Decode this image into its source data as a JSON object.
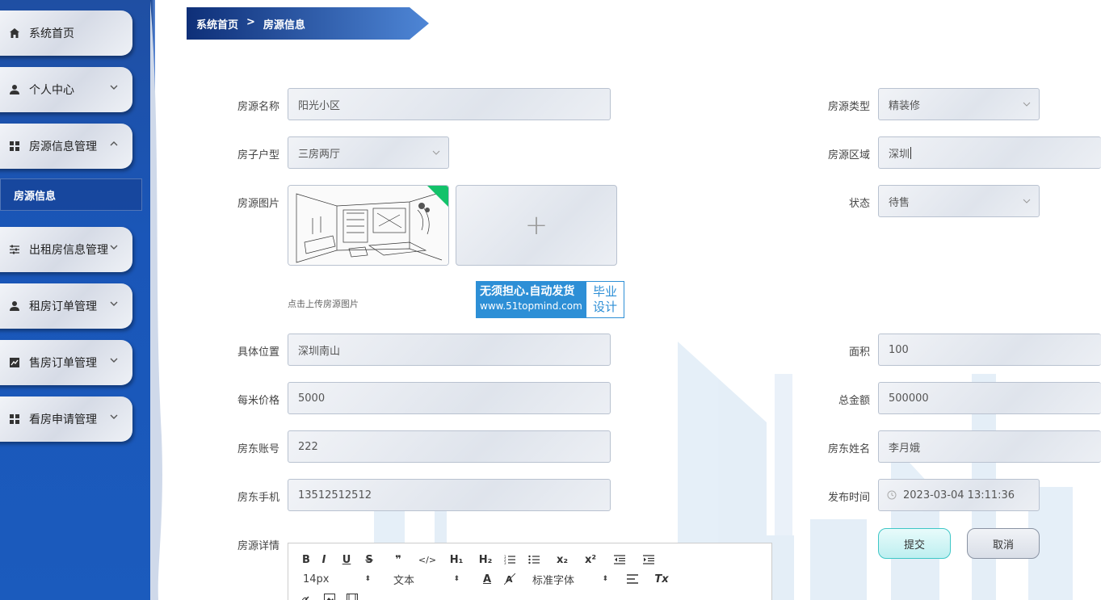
{
  "sidebar": {
    "items": [
      {
        "label": "系统首页",
        "icon": "home-icon"
      },
      {
        "label": "个人中心",
        "icon": "user-icon"
      },
      {
        "label": "房源信息管理",
        "icon": "grid-icon"
      },
      {
        "label": "出租房信息管理",
        "icon": "sliders-icon"
      },
      {
        "label": "租房订单管理",
        "icon": "user-icon"
      },
      {
        "label": "售房订单管理",
        "icon": "chart-icon"
      },
      {
        "label": "看房申请管理",
        "icon": "grid-icon"
      }
    ],
    "active_sub": "房源信息"
  },
  "breadcrumb": {
    "home": "系统首页",
    "sep": ">",
    "current": "房源信息"
  },
  "form": {
    "name": {
      "label": "房源名称",
      "value": "阳光小区"
    },
    "type": {
      "label": "房源类型",
      "value": "精装修"
    },
    "layout": {
      "label": "房子户型",
      "value": "三房两厅"
    },
    "region": {
      "label": "房源区域",
      "value": "深圳"
    },
    "image": {
      "label": "房源图片",
      "hint": "点击上传房源图片",
      "upload_symbol": "+"
    },
    "status": {
      "label": "状态",
      "value": "待售"
    },
    "location": {
      "label": "具体位置",
      "value": "深圳南山"
    },
    "area": {
      "label": "面积",
      "value": "100"
    },
    "unit_price": {
      "label": "每米价格",
      "value": "5000"
    },
    "total": {
      "label": "总金额",
      "value": "500000"
    },
    "owner_account": {
      "label": "房东账号",
      "value": "222"
    },
    "owner_name": {
      "label": "房东姓名",
      "value": "李月娥"
    },
    "owner_phone": {
      "label": "房东手机",
      "value": "13512512512"
    },
    "publish_time": {
      "label": "发布时间",
      "value": "2023-03-04 13:11:36"
    },
    "detail": {
      "label": "房源详情"
    }
  },
  "buttons": {
    "submit": "提交",
    "cancel": "取消"
  },
  "watermark": {
    "line1": "无须担心.自动发货",
    "line2": "www.51topmind.com",
    "right1": "毕业",
    "right2": "设计"
  },
  "editor": {
    "font_size": "14px",
    "paragraph": "文本",
    "font_family": "标准字体",
    "toolbar": {
      "bold": "B",
      "italic": "I",
      "underline": "U",
      "strike": "S",
      "quote": "❞",
      "code": "</>",
      "h1": "H₁",
      "h2": "H₂",
      "sub": "x₂",
      "sup": "x²",
      "clear": "Tx"
    }
  },
  "colors": {
    "sidebar": "#1b5bbd",
    "accent": "#1f4fa3",
    "submit_border": "#3fc7c7",
    "img_corner": "#13c26a"
  }
}
